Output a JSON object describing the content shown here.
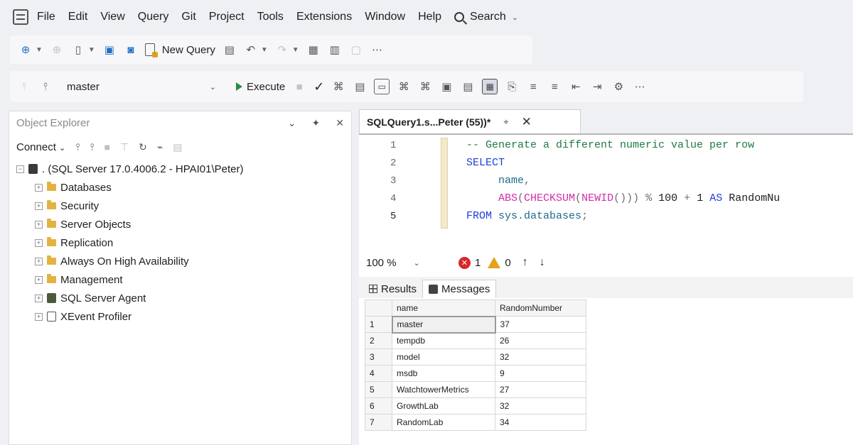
{
  "menu": {
    "items": [
      "File",
      "Edit",
      "View",
      "Query",
      "Git",
      "Project",
      "Tools",
      "Extensions",
      "Window",
      "Help"
    ],
    "search_label": "Search"
  },
  "toolbar1": {
    "new_query_label": "New Query"
  },
  "toolbar2": {
    "database": "master",
    "execute_label": "Execute"
  },
  "object_explorer": {
    "title": "Object Explorer",
    "connect_label": "Connect",
    "server": ". (SQL Server 17.0.4006.2 - HPAI01\\Peter)",
    "nodes": [
      "Databases",
      "Security",
      "Server Objects",
      "Replication",
      "Always On High Availability",
      "Management",
      "SQL Server Agent",
      "XEvent Profiler"
    ]
  },
  "query_tab": {
    "title": "SQLQuery1.s...Peter (55))*"
  },
  "editor": {
    "line_numbers": [
      "1",
      "2",
      "3",
      "4",
      "5"
    ],
    "line1": "-- Generate a different numeric value per row",
    "select_kw": "SELECT",
    "name_col": "name",
    "abs_fn": "ABS",
    "checksum_fn": "CHECKSUM",
    "newid_fn": "NEWID",
    "op_mod": "%",
    "num_100": "100",
    "op_plus": "+",
    "num_1": "1",
    "as_kw": "AS",
    "alias": "RandomNu",
    "from_kw": "FROM",
    "from_obj": "sys.databases"
  },
  "status": {
    "zoom": "100 %",
    "errors": "1",
    "warnings": "0"
  },
  "results_tabs": {
    "results": "Results",
    "messages": "Messages"
  },
  "results": {
    "columns": [
      "name",
      "RandomNumber"
    ],
    "rows": [
      {
        "n": "1",
        "name": "master",
        "value": "37"
      },
      {
        "n": "2",
        "name": "tempdb",
        "value": "26"
      },
      {
        "n": "3",
        "name": "model",
        "value": "32"
      },
      {
        "n": "4",
        "name": "msdb",
        "value": "9"
      },
      {
        "n": "5",
        "name": "WatchtowerMetrics",
        "value": "27"
      },
      {
        "n": "6",
        "name": "GrowthLab",
        "value": "32"
      },
      {
        "n": "7",
        "name": "RandomLab",
        "value": "34"
      }
    ]
  }
}
